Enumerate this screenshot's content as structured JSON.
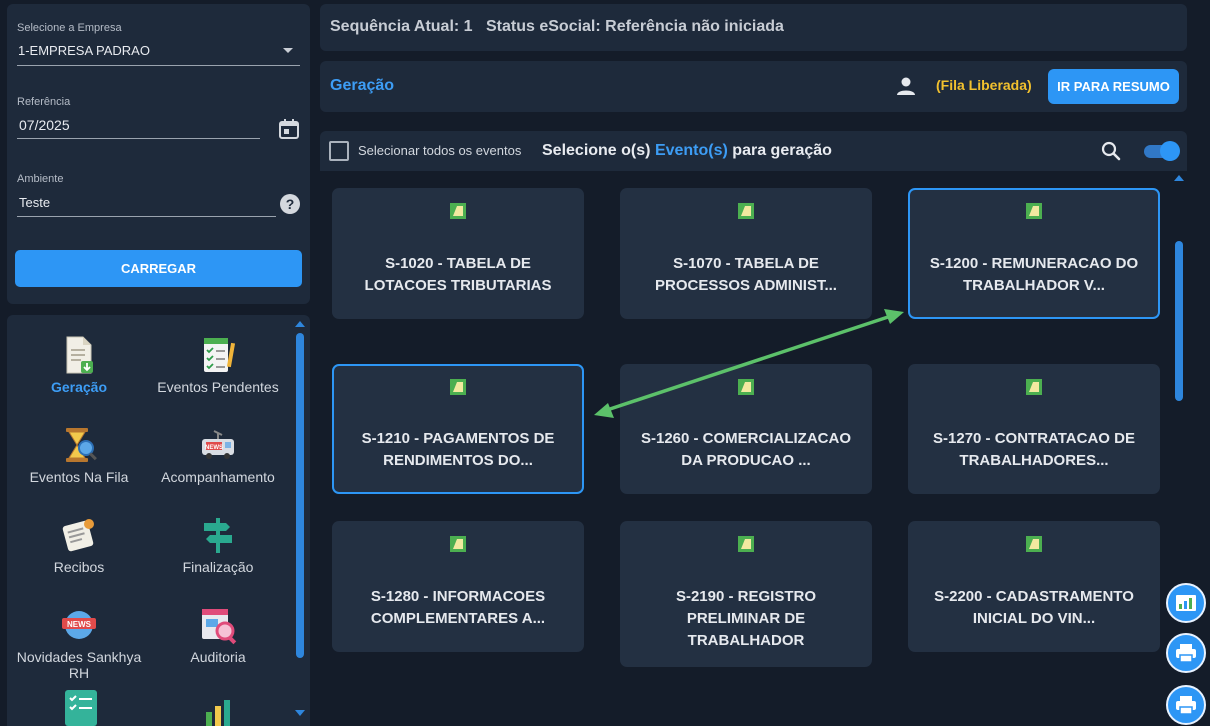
{
  "filters": {
    "empresa_label": "Selecione a Empresa",
    "empresa_value": "1-EMPRESA PADRAO",
    "referencia_label": "Referência",
    "referencia_value": "07/2025",
    "ambiente_label": "Ambiente",
    "ambiente_value": "Teste",
    "carregar_label": "CARREGAR"
  },
  "menu": {
    "items": [
      {
        "label": "Geração",
        "icon": "document-download-icon",
        "active": true
      },
      {
        "label": "Eventos Pendentes",
        "icon": "checklist-pencil-icon"
      },
      {
        "label": "Eventos Na Fila",
        "icon": "hourglass-search-icon"
      },
      {
        "label": "Acompanhamento",
        "icon": "news-van-icon"
      },
      {
        "label": "Recibos",
        "icon": "receipt-icon"
      },
      {
        "label": "Finalização",
        "icon": "signpost-icon"
      },
      {
        "label": "Novidades Sankhya RH",
        "icon": "news-globe-icon"
      },
      {
        "label": "Auditoria",
        "icon": "audit-magnifier-icon"
      }
    ]
  },
  "status": {
    "sequencia": "Sequência Atual: 1",
    "esocial": "Status eSocial: Referência não iniciada"
  },
  "header": {
    "title": "Geração",
    "fila": "(Fila Liberada)",
    "resumo_button": "IR PARA RESUMO"
  },
  "selection": {
    "select_all": "Selecionar todos os eventos",
    "title_prefix": "Selecione o(s)",
    "title_highlight": "Evento(s)",
    "title_suffix": "para geração",
    "toggle_on": true
  },
  "cards": [
    {
      "line1": "S-1020 - TABELA DE",
      "line2": "LOTACOES TRIBUTARIAS",
      "line3": "",
      "selected": false
    },
    {
      "line1": "S-1070 - TABELA DE",
      "line2": "PROCESSOS ADMINIST...",
      "line3": "",
      "selected": false
    },
    {
      "line1": "S-1200 - REMUNERACAO DO",
      "line2": "TRABALHADOR V...",
      "line3": "",
      "selected": true
    },
    {
      "line1": "S-1210 - PAGAMENTOS DE",
      "line2": "RENDIMENTOS DO...",
      "line3": "",
      "selected": true
    },
    {
      "line1": "S-1260 - COMERCIALIZACAO",
      "line2": "DA PRODUCAO ...",
      "line3": "",
      "selected": false
    },
    {
      "line1": "S-1270 - CONTRATACAO DE",
      "line2": "TRABALHADORES...",
      "line3": "",
      "selected": false
    },
    {
      "line1": "S-1280 - INFORMACOES",
      "line2": "COMPLEMENTARES A...",
      "line3": "",
      "selected": false
    },
    {
      "line1": "S-2190 - REGISTRO",
      "line2": "PRELIMINAR DE",
      "line3": "TRABALHADOR",
      "selected": false
    },
    {
      "line1": "S-2200 - CADASTRAMENTO",
      "line2": "INICIAL DO VIN...",
      "line3": "",
      "selected": false
    }
  ],
  "colors": {
    "accent": "#2d96f5",
    "fila": "#f2c12e",
    "arrow": "#5cc16a",
    "panel": "#1e2a3b",
    "card": "#233042"
  }
}
